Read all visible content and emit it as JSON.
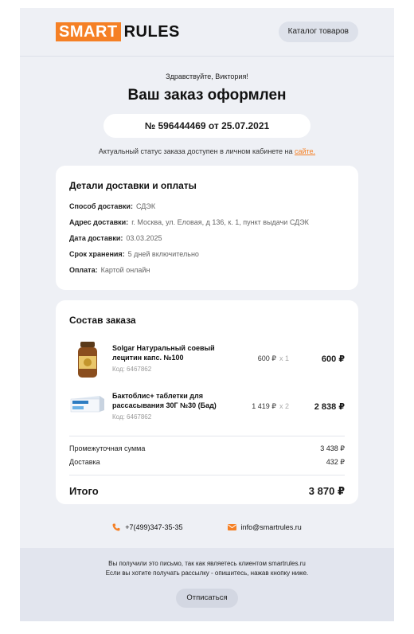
{
  "logo": {
    "part1": "SMART",
    "part2": "RULES"
  },
  "header": {
    "catalog_label": "Каталог товаров"
  },
  "greeting": "Здравствуйте, Виктория!",
  "title": "Ваш заказ оформлен",
  "order_number": "№ 596444469 от 25.07.2021",
  "status_note": {
    "text": "Актуальный статус заказа доступен в личном кабинете на ",
    "link": "сайте."
  },
  "delivery": {
    "heading": "Детали доставки и оплаты",
    "rows": [
      {
        "label": "Способ доставки:",
        "value": "СДЭК"
      },
      {
        "label": "Адрес доставки:",
        "value": "г. Москва, ул. Еловая, д 136, к. 1, пункт выдачи СДЭК"
      },
      {
        "label": "Дата доставки:",
        "value": "03.03.2025"
      },
      {
        "label": "Срок хранения:",
        "value": "5 дней включительно"
      },
      {
        "label": "Оплата:",
        "value": "Картой онлайн"
      }
    ]
  },
  "order": {
    "heading": "Состав заказа",
    "items": [
      {
        "name": "Solgar Натуральный соевый лецитин капс. №100",
        "code": "Код: 6467862",
        "price": "600 ₽",
        "qty": "x 1",
        "sum": "600 ₽",
        "image": "supplement-jar"
      },
      {
        "name": "Бактоблис+ таблетки для рассасывания 30Г №30 (Бад)",
        "code": "Код: 6467862",
        "price": "1 419 ₽",
        "qty": "x 2",
        "sum": "2 838 ₽",
        "image": "medicine-box"
      }
    ],
    "subtotal_label": "Промежуточная сумма",
    "subtotal": "3 438 ₽",
    "delivery_label": "Доставка",
    "delivery_cost": "432 ₽",
    "total_label": "Итого",
    "total": "3 870 ₽"
  },
  "contacts": {
    "phone": "+7(499)347-35-35",
    "email": "info@smartrules.ru",
    "icon_color": "#f58025"
  },
  "footer": {
    "line1": "Вы получили это письмо, так как являетесь клиентом smartrules.ru",
    "line2": "Если вы хотите получать рассылку - опишитесь, нажав кнопку ниже.",
    "unsubscribe": "Отписаться"
  },
  "colors": {
    "accent": "#f58025",
    "background": "#eef0f5"
  }
}
